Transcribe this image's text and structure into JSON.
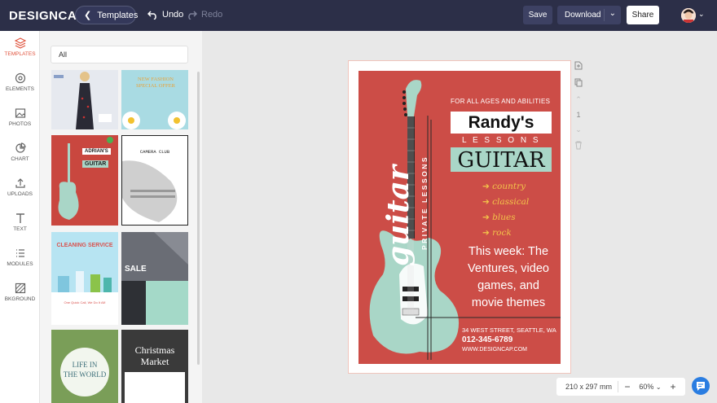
{
  "app": {
    "logo": "DESIGNCAP",
    "templates_button": "Templates",
    "undo_label": "Undo",
    "redo_label": "Redo",
    "save_label": "Save",
    "download_label": "Download",
    "share_label": "Share"
  },
  "rail": [
    {
      "label": "TEMPLATES",
      "icon": "layers-icon"
    },
    {
      "label": "ELEMENTS",
      "icon": "elements-icon"
    },
    {
      "label": "PHOTOS",
      "icon": "photo-icon"
    },
    {
      "label": "CHART",
      "icon": "chart-icon"
    },
    {
      "label": "UPLOADS",
      "icon": "upload-icon"
    },
    {
      "label": "TEXT",
      "icon": "text-icon"
    },
    {
      "label": "MODULES",
      "icon": "modules-icon"
    },
    {
      "label": "BKGROUND",
      "icon": "background-icon"
    }
  ],
  "panel": {
    "filter_value": "All",
    "thumbs": {
      "fashion_offer": [
        "NEW FASHION",
        "SPECIAL OFFER"
      ],
      "adrians_name": "ADRIAN'S",
      "adrians_guitar": "GUITAR",
      "camera_club": "CAMERA CLUB",
      "cleaning_service": "CLEANING SERVICE",
      "cleaning_call": "One Quick Call, We Do It All!",
      "sale": "SALE",
      "life_world": [
        "LIFE IN",
        "THE WORLD"
      ],
      "christmas": [
        "Christmas",
        "Market"
      ]
    }
  },
  "poster": {
    "tagline": "FOR ALL AGES AND ABILITIES",
    "name": "Randy's",
    "lessons": "L E S S O N S",
    "guitar_title": "GUITAR",
    "guitar_script": "guitar",
    "private_lessons": "PRIVATE LESSONS",
    "genres": [
      "country",
      "classical",
      "blues",
      "rock"
    ],
    "this_week": [
      "This week: The",
      "Ventures, video",
      "games, and",
      "movie themes"
    ],
    "address": "34 WEST STREET, SEATTLE, WA",
    "phone": "012-345-6789",
    "website": "WWW.DESIGNCAP.COM"
  },
  "side_tools": {
    "page_number": "1"
  },
  "zoom": {
    "size_label": "210 x 297 mm",
    "zoom_label": "60%",
    "minus": "−",
    "plus": "+"
  },
  "colors": {
    "topbar": "#2c2f48",
    "accent": "#e0533d",
    "poster_red": "#cc4d47",
    "mint": "#a9d6c7",
    "genre_yellow": "#f3c44a"
  }
}
